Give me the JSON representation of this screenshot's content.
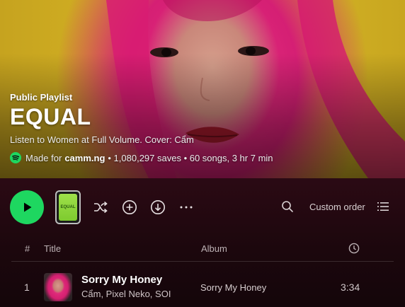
{
  "playlist": {
    "type_label": "Public Playlist",
    "title": "EQUAL",
    "description": "Listen to Women at Full Volume. Cover: Cẩm",
    "made_for_label": "Made for",
    "user": "camm.ng",
    "stats": "• 1,080,297 saves • 60 songs, 3 hr 7 min"
  },
  "controls": {
    "thumb_label": "EQUAL",
    "sort_label": "Custom order"
  },
  "table": {
    "headers": {
      "num": "#",
      "title": "Title",
      "album": "Album"
    },
    "rows": [
      {
        "num": "1",
        "title": "Sorry My Honey",
        "artists": "Cẩm, Pixel Neko, SOI",
        "album": "Sorry My Honey",
        "duration": "3:34"
      }
    ]
  },
  "colors": {
    "accent": "#1ed760",
    "background": "#1c070d",
    "cover_yellow": "#d7b524",
    "cover_pink": "#e8317f"
  },
  "icons": [
    "play-icon",
    "shuffle-icon",
    "add-circle-icon",
    "download-icon",
    "more-icon",
    "search-icon",
    "list-icon",
    "clock-icon",
    "spotify-logo"
  ]
}
